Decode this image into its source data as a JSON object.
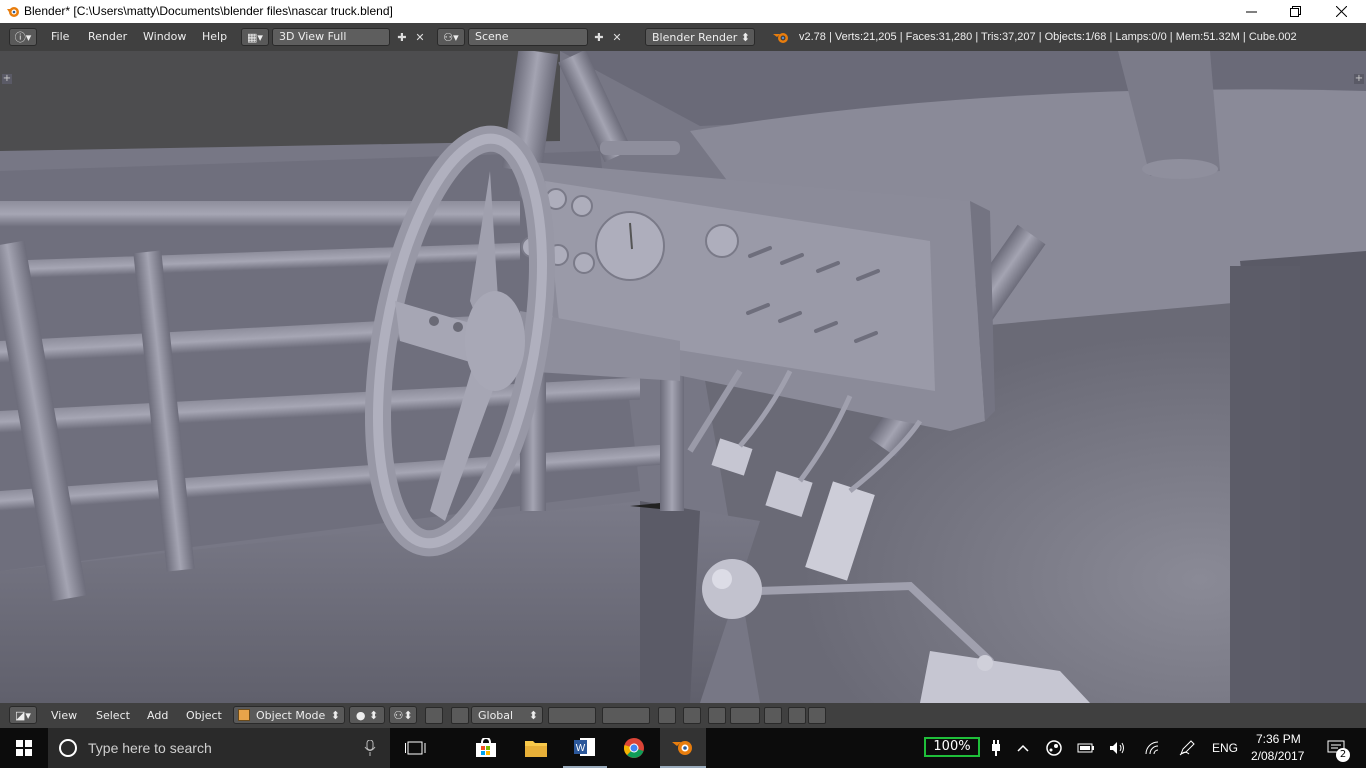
{
  "window": {
    "title": "Blender* [C:\\Users\\matty\\Documents\\blender files\\nascar truck.blend]"
  },
  "header": {
    "menus": [
      "File",
      "Render",
      "Window",
      "Help"
    ],
    "screen_layout": "3D View Full",
    "scene": "Scene",
    "render_engine": "Blender Render",
    "stats": "v2.78 | Verts:21,205 | Faces:31,280 | Tris:37,207 | Objects:1/68 | Lamps:0/0 | Mem:51.32M | Cube.002"
  },
  "footer": {
    "menus": [
      "View",
      "Select",
      "Add",
      "Object"
    ],
    "mode": "Object Mode",
    "transform_orientation": "Global"
  },
  "taskbar": {
    "search_placeholder": "Type here to search",
    "battery": "100%",
    "language": "ENG",
    "time": "7:36 PM",
    "date": "2/08/2017",
    "notification_count": "2"
  },
  "colors": {
    "header_bg": "#404040",
    "viewport_bg": "#787886",
    "taskbar_bg": "#0c0c0c",
    "battery_border": "#1fbf3a",
    "blender_orange": "#e87d0d"
  }
}
